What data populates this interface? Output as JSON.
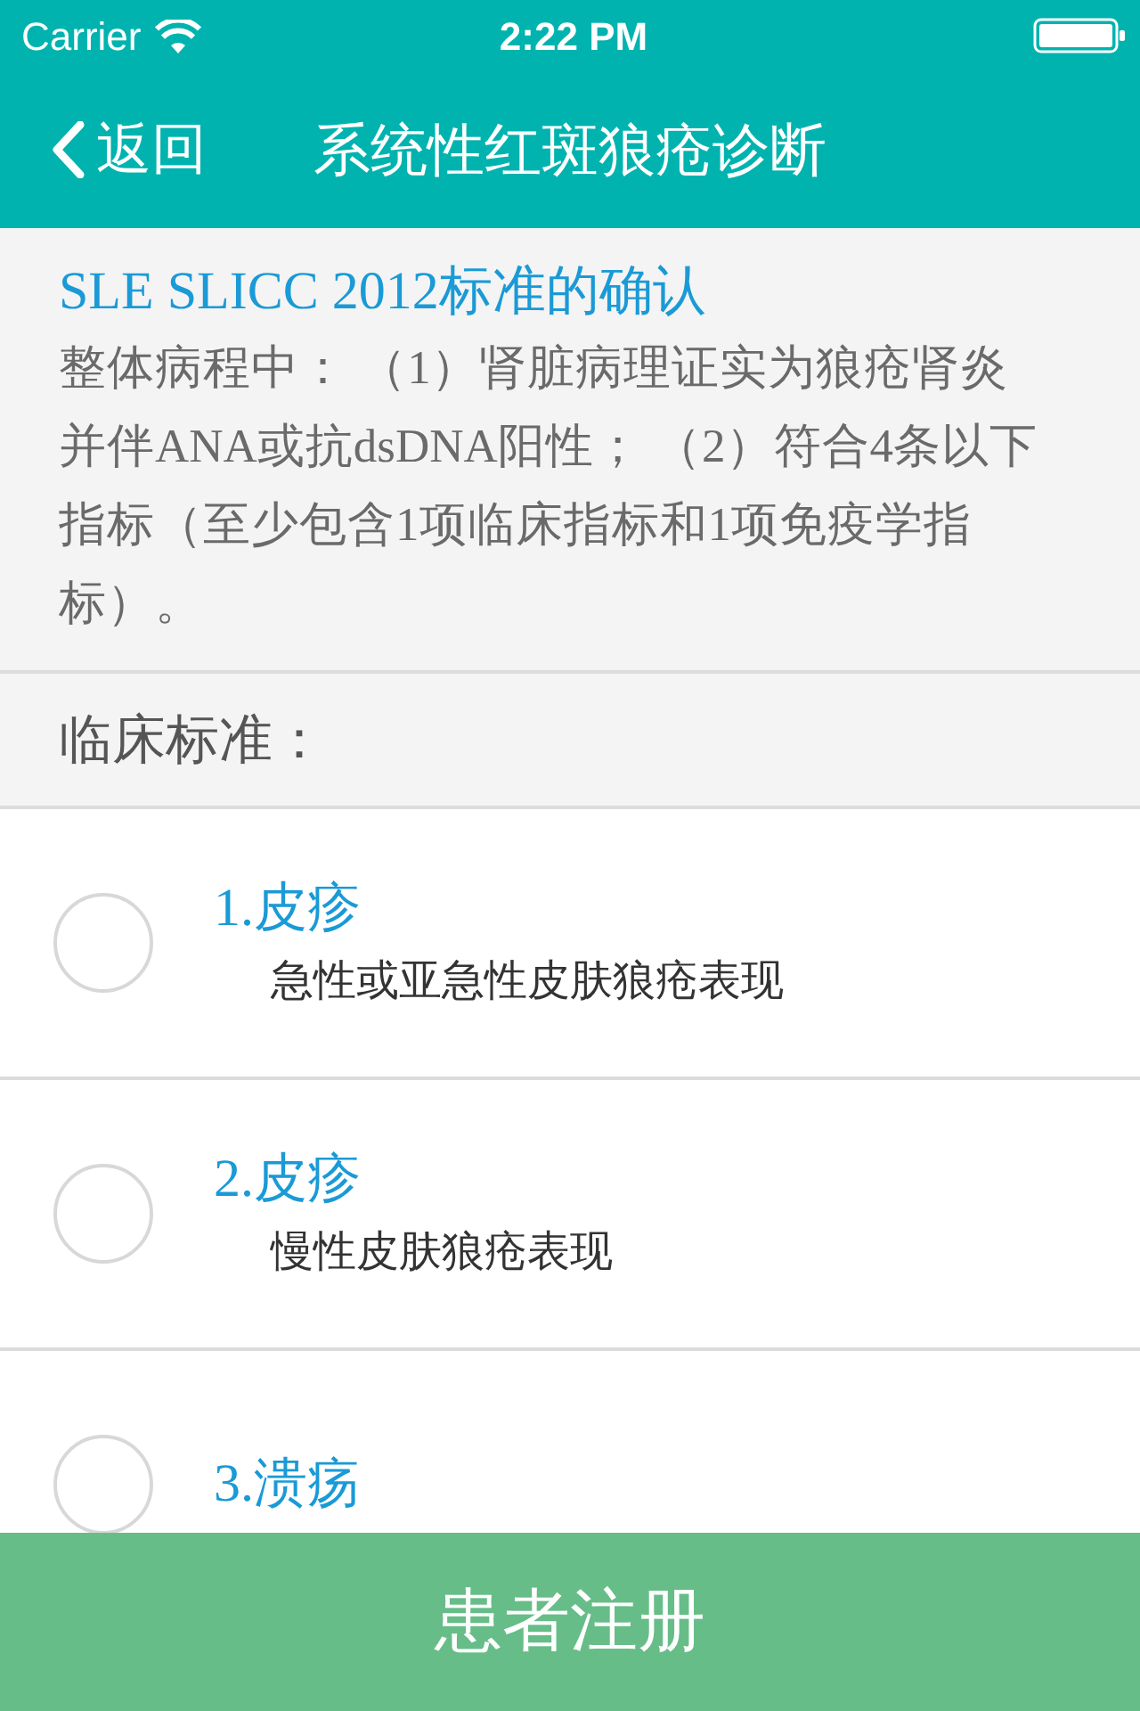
{
  "status_bar": {
    "carrier": "Carrier",
    "time": "2:22 PM"
  },
  "nav_bar": {
    "back": "返回",
    "title": "系统性红斑狼疮诊断"
  },
  "info": {
    "title": "SLE SLICC 2012标准的确认",
    "body": "整体病程中： （1）肾脏病理证实为狼疮肾炎并伴ANA或抗dsDNA阳性； （2）符合4条以下指标（至少包含1项临床指标和1项免疫学指标）。"
  },
  "section": {
    "label": "临床标准："
  },
  "criteria": [
    {
      "title": "1.皮疹",
      "description": "急性或亚急性皮肤狼疮表现",
      "checked": false
    },
    {
      "title": "2.皮疹",
      "description": "慢性皮肤狼疮表现",
      "checked": false
    },
    {
      "title": "3.溃疡",
      "checked": false
    }
  ],
  "footer_button": {
    "label": "患者注册"
  }
}
